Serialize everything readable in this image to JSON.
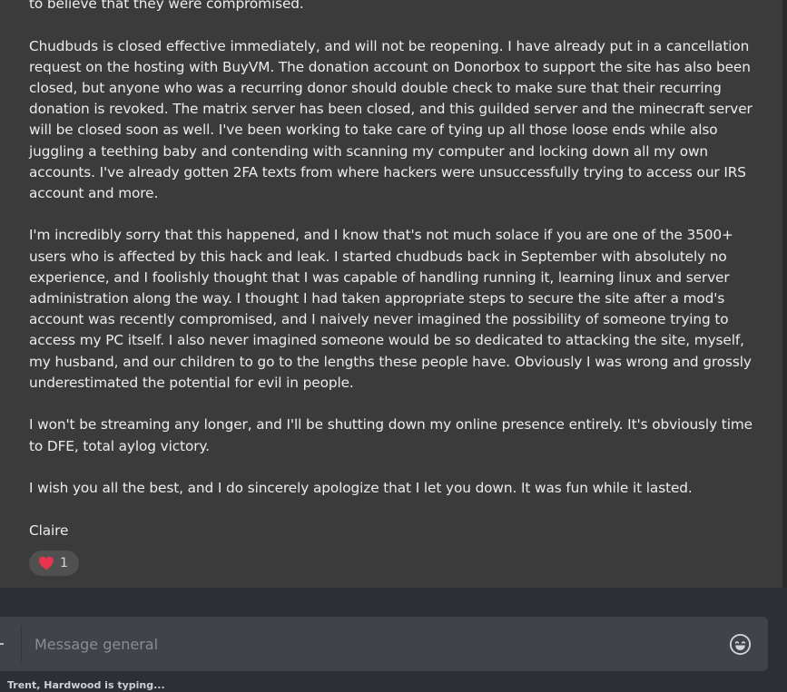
{
  "message": {
    "paragraphs": [
      "to believe that they were compromised.",
      "Chudbuds is closed effective immediately, and will not be reopening. I have already put in a cancellation request on the hosting with BuyVM. The donation account on Donorbox to support the site has also been closed, but anyone who was a recurring donor should double check to make sure that their recurring donation is revoked. The matrix server has been closed, and this guilded server and the minecraft server will be closed soon as well. I've been working to take care of tying up all those loose ends while also juggling a teething baby and contending with scanning my computer and locking down all my own accounts. I've already gotten 2FA texts from where hackers were unsuccessfully trying to access our IRS account and more.",
      "I'm incredibly sorry that this happened, and I know that's not much solace if you are one of the 3500+ users who is affected by this hack and leak. I started chudbuds back in September with absolutely no experience, and I foolishly thought that I was capable of handling running it, learning linux and server administration along the way. I thought I had taken appropriate steps to secure the site after a mod's account was recently compromised, and I naively never imagined the possibility of someone trying to access my PC itself. I also never imagined someone would be so dedicated to attacking the site, myself, my husband, and our children to go to the lengths these people have. Obviously I was wrong and grossly underestimated the potential for evil in people.",
      "I won't be streaming any longer, and I'll be shutting down my online presence entirely. It's obviously time to DFE, total aylog victory.",
      "I wish you all the best, and I do sincerely apologize that I let you down. It was fun while it lasted."
    ],
    "signature": "Claire"
  },
  "reaction": {
    "icon": "heart-icon",
    "count": "1",
    "color": "#e8344e"
  },
  "composer": {
    "placeholder": "Message general",
    "emoji_icon": "smiley-face-icon"
  },
  "typing_indicator": "Trent, Hardwood is typing..."
}
